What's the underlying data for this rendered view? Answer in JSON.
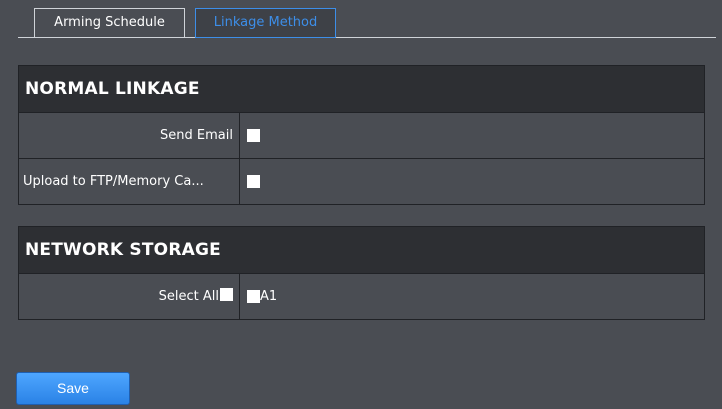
{
  "tabs": [
    {
      "label": "Arming Schedule",
      "active": false
    },
    {
      "label": "Linkage Method",
      "active": true
    }
  ],
  "normal_linkage": {
    "title": "NORMAL LINKAGE",
    "rows": [
      {
        "label": "Send Email",
        "checked": false
      },
      {
        "label": "Upload to FTP/Memory Ca...",
        "checked": false
      }
    ]
  },
  "network_storage": {
    "title": "NETWORK STORAGE",
    "select_all_label": "Select All",
    "select_all_checked": false,
    "channels": [
      {
        "label": "A1",
        "checked": false
      }
    ]
  },
  "save_label": "Save",
  "colors": {
    "background": "#4a4d53",
    "panel_header": "#2d2f33",
    "accent": "#3d8ee8",
    "button": "#2a82e6"
  }
}
